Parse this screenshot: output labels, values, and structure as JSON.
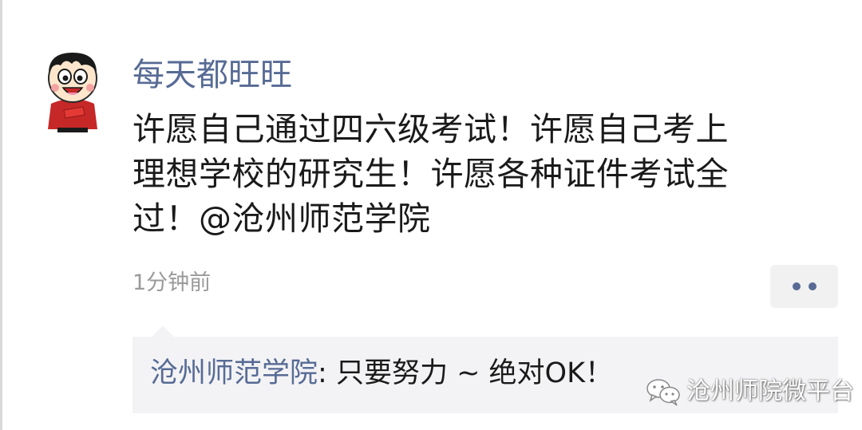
{
  "post": {
    "username": "每天都旺旺",
    "text_lines": [
      "许愿自己通过四六级考试！许愿自己考上",
      "理想学校的研究生！许愿各种证件考试全",
      "过！@沧州师范学院"
    ],
    "timestamp": "1分钟前",
    "avatar_icon": "wangzai-cartoon-avatar"
  },
  "more_button": {
    "icon": "more-dots-icon"
  },
  "comment": {
    "author": "沧州师范学院",
    "separator": ": ",
    "text": "只要努力 ~ 绝对OK！"
  },
  "watermark": {
    "text": "沧州师院微平台",
    "icon": "wechat-icon"
  },
  "colors": {
    "link_blue": "#576b95",
    "text": "#1a1a1a",
    "muted": "#9a9a9a",
    "comment_bg": "#f3f3f5",
    "avatar_red": "#c62828"
  }
}
